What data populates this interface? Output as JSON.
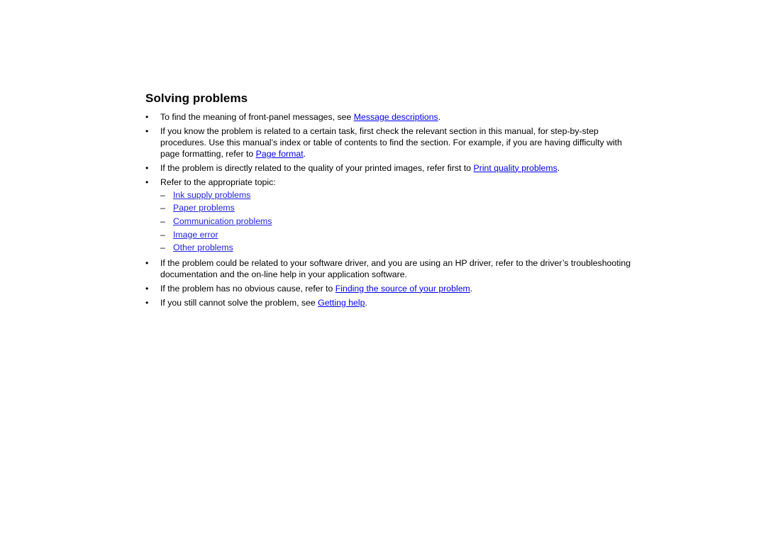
{
  "document": {
    "heading": "Solving problems",
    "bullet_marker": "•",
    "dash_marker": "–",
    "link_color": "#0000ee",
    "text_color": "#000000",
    "background_color": "#ffffff",
    "bullets": [
      {
        "segments_text": {
          "before": "To find the meaning of front-panel messages, see ",
          "link": "Message descriptions",
          "after": "."
        }
      },
      {
        "segments_text": {
          "before": "If you know the problem is related to a certain task, first check the relevant section in this manual, for step-by-step procedures. Use this manual’s index or table of contents to find the section. For example, if you are having difficulty with page formatting, refer to ",
          "link": "Page format",
          "after": "."
        }
      },
      {
        "segments_text": {
          "before": "If the problem is directly related to the quality of your printed images, refer first to ",
          "link": "Print quality problems",
          "after": "."
        }
      },
      {
        "segments_text": {
          "before": "Refer to the appropriate topic:",
          "link": "",
          "after": ""
        }
      },
      {
        "segments_text": {
          "before": "If the problem could be related to your software driver, and you are using an HP driver, refer to the driver’s troubleshooting documentation and the on-line help in your application software.",
          "link": "",
          "after": ""
        }
      },
      {
        "segments_text": {
          "before": "If the problem has no obvious cause, refer to ",
          "link": "Finding the source of your problem",
          "after": "."
        }
      },
      {
        "segments_text": {
          "before": "If you still cannot solve the problem, see ",
          "link": "Getting help",
          "after": "."
        }
      }
    ],
    "topic_links": [
      "Ink supply problems",
      "Paper problems",
      "Communication problems",
      "Image error",
      "Other problems"
    ]
  }
}
